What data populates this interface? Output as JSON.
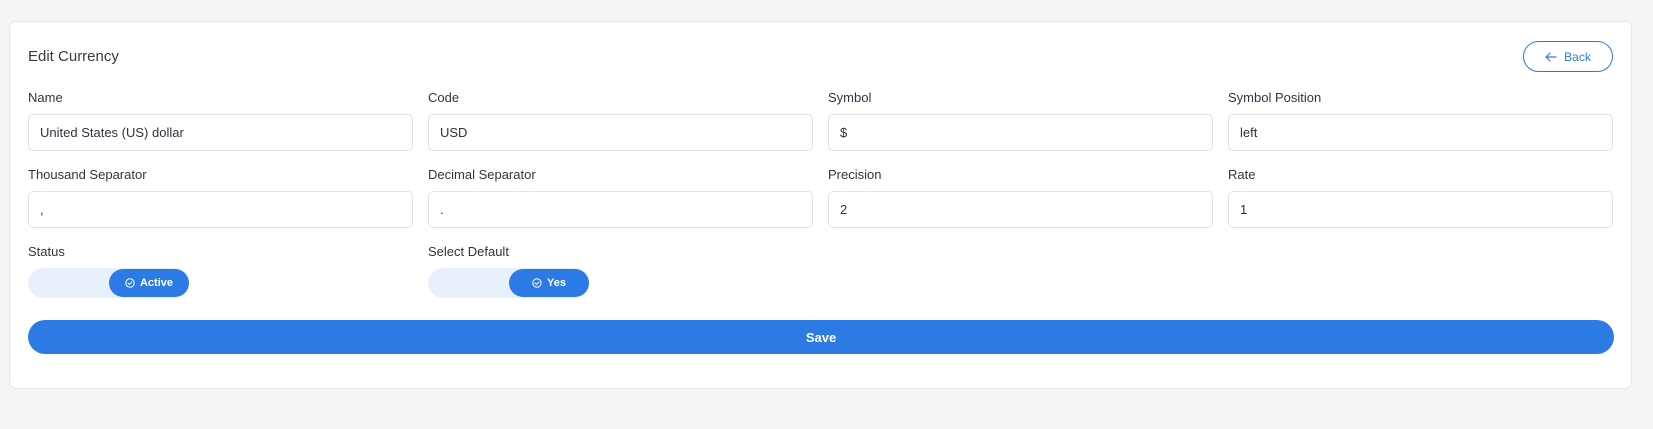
{
  "header": {
    "title": "Edit Currency",
    "back_label": "Back"
  },
  "form": {
    "fields": [
      {
        "label": "Name",
        "value": "United States (US) dollar"
      },
      {
        "label": "Code",
        "value": "USD"
      },
      {
        "label": "Symbol",
        "value": "$"
      },
      {
        "label": "Symbol Position",
        "value": "left"
      },
      {
        "label": "Thousand Separator",
        "value": ","
      },
      {
        "label": "Decimal Separator",
        "value": "."
      },
      {
        "label": "Precision",
        "value": "2"
      },
      {
        "label": "Rate",
        "value": "1"
      }
    ],
    "status": {
      "label": "Status",
      "value": "Active",
      "on": true
    },
    "select_default": {
      "label": "Select Default",
      "value": "Yes",
      "on": true
    },
    "save_label": "Save"
  },
  "colors": {
    "accent": "#2c7be5",
    "switch_track": "#e8f0fb"
  },
  "icons": {
    "back": "arrow-left-icon",
    "toggle": "check-circle-icon"
  }
}
